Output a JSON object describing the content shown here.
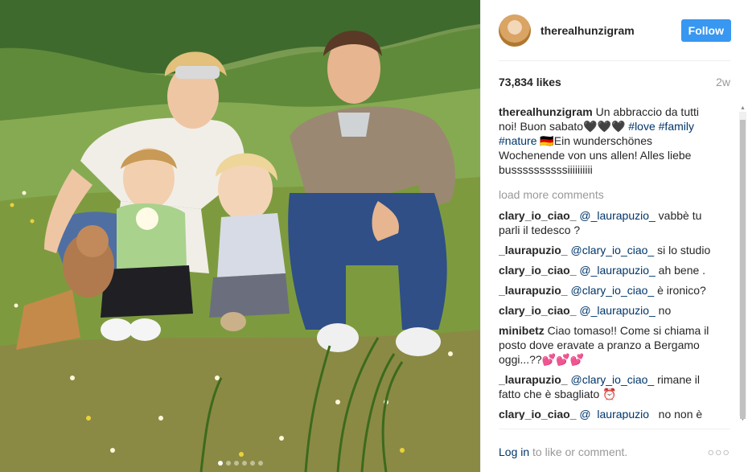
{
  "header": {
    "username": "therealhunzigram",
    "follow_label": "Follow",
    "avatar_icon": "avatar"
  },
  "likes": "73,834 likes",
  "time": "2w",
  "caption": {
    "user": "therealhunzigram",
    "text_1": "Un abbraccio da tutti noi! Buon sabato🖤🖤🖤 ",
    "tag_love": "#love",
    "tag_family": "#family",
    "tag_nature": "#nature",
    "text_2": " 🇩🇪Ein wunderschönes Wochenende von uns allen! Alles liebe bussssssssssiiiiiiiiii"
  },
  "load_more": "load more comments",
  "comments": [
    {
      "user": "clary_io_ciao_",
      "mention": "@_laurapuzio_",
      "text": " vabbè tu parli il tedesco ?"
    },
    {
      "user": "_laurapuzio_",
      "mention": "@clary_io_ciao_",
      "text": " si lo studio"
    },
    {
      "user": "clary_io_ciao_",
      "mention": "@_laurapuzio_",
      "text": " ah bene ."
    },
    {
      "user": "_laurapuzio_",
      "mention": "@clary_io_ciao_",
      "text": " è ironico?"
    },
    {
      "user": "clary_io_ciao_",
      "mention": "@_laurapuzio_",
      "text": " no"
    },
    {
      "user": "minibetz",
      "mention": "",
      "text": "Ciao tomaso!! Come si chiama il posto dove eravate a pranzo a Bergamo oggi...??💕💕💕"
    },
    {
      "user": "_laurapuzio_",
      "mention": "@clary_io_ciao_",
      "text": " rimane il fatto che è sbagliato ⏰"
    },
    {
      "user": "clary_io_ciao_",
      "mention": "@_laurapuzio_",
      "text": " no non è sbagliato"
    }
  ],
  "footer": {
    "login_link": "Log in",
    "login_rest": " to like or comment.",
    "more_icon": "more-options-icon"
  },
  "carousel": {
    "total_images": 6,
    "active_index": 0
  },
  "colors": {
    "accent": "#3897f0",
    "link": "#003569",
    "muted": "#999999",
    "text": "#262626"
  }
}
